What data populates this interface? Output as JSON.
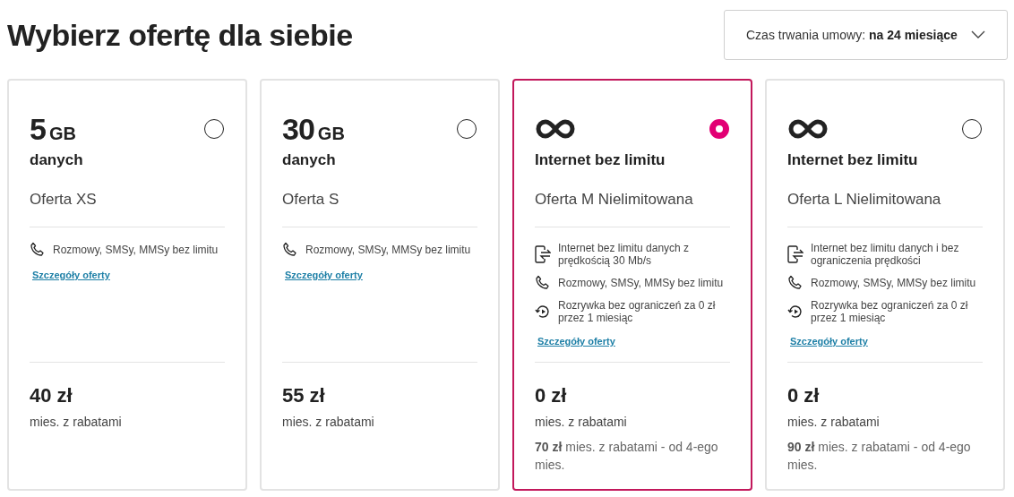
{
  "title": "Wybierz ofertę dla siebie",
  "duration": {
    "label": "Czas trwania umowy:",
    "value": "na 24 miesiące"
  },
  "cards": [
    {
      "kind": "data",
      "amount": "5",
      "unit": "GB",
      "title": "danych",
      "name": "Oferta XS",
      "selected": false,
      "features": [
        {
          "kind": "calls",
          "text": "Rozmowy, SMSy, MMSy bez limitu"
        }
      ],
      "link": "Szczegóły oferty",
      "price": "40 zł",
      "price_note": "mies. z rabatami"
    },
    {
      "kind": "data",
      "amount": "30",
      "unit": "GB",
      "title": "danych",
      "name": "Oferta S",
      "selected": false,
      "features": [
        {
          "kind": "calls",
          "text": "Rozmowy, SMSy, MMSy bez limitu"
        }
      ],
      "link": "Szczegóły oferty",
      "price": "55 zł",
      "price_note": "mies. z rabatami"
    },
    {
      "kind": "unlimited",
      "title": "Internet bez limitu",
      "name": "Oferta M Nielimitowana",
      "selected": true,
      "features": [
        {
          "kind": "internet",
          "text": "Internet bez limitu danych z prędkością 30 Mb/s"
        },
        {
          "kind": "calls",
          "text": "Rozmowy, SMSy, MMSy bez limitu"
        },
        {
          "kind": "entertainment",
          "text": "Rozrywka bez ograniczeń za 0 zł przez 1 miesiąc"
        }
      ],
      "link": "Szczegóły oferty",
      "price": "0 zł",
      "price_note": "mies. z rabatami",
      "later_note": "**70 zł** mies. z rabatami - od 4-ego mies."
    },
    {
      "kind": "unlimited",
      "title": "Internet bez limitu",
      "name": "Oferta L Nielimitowana",
      "selected": false,
      "features": [
        {
          "kind": "internet",
          "text": "Internet bez limitu danych i bez ograniczenia prędkości"
        },
        {
          "kind": "calls",
          "text": "Rozmowy, SMSy, MMSy bez limitu"
        },
        {
          "kind": "entertainment",
          "text": "Rozrywka bez ograniczeń za 0 zł przez 1 miesiąc"
        }
      ],
      "link": "Szczegóły oferty",
      "price": "0 zł",
      "price_note": "mies. z rabatami",
      "later_note": "**90 zł** mies. z rabatami - od 4-ego mies."
    }
  ]
}
